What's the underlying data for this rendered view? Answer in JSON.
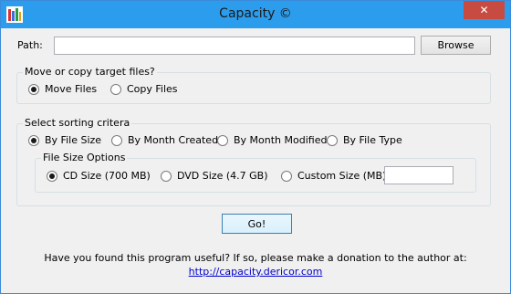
{
  "window": {
    "title": "Capacity ©",
    "close_label": "✕",
    "app_icon": "app-icon"
  },
  "path": {
    "label": "Path:",
    "value": "",
    "browse_label": "Browse"
  },
  "move_copy": {
    "title": "Move or copy target files?",
    "options": [
      {
        "label": "Move Files",
        "checked": true
      },
      {
        "label": "Copy Files",
        "checked": false
      }
    ]
  },
  "sorting": {
    "title": "Select sorting critera",
    "options": [
      {
        "label": "By File Size",
        "checked": true
      },
      {
        "label": "By Month Created",
        "checked": false
      },
      {
        "label": "By Month Modified",
        "checked": false
      },
      {
        "label": "By File Type",
        "checked": false
      }
    ]
  },
  "size_options": {
    "title": "File Size Options",
    "options": [
      {
        "label": "CD Size (700 MB)",
        "checked": true
      },
      {
        "label": "DVD Size (4.7 GB)",
        "checked": false
      },
      {
        "label": "Custom Size (MB)",
        "checked": false
      }
    ],
    "custom_value": ""
  },
  "go_label": "Go!",
  "footer": {
    "text": "Have you found this program useful?  If so, please make a donation to the author at:",
    "link": "http://capacity.dericor.com"
  }
}
